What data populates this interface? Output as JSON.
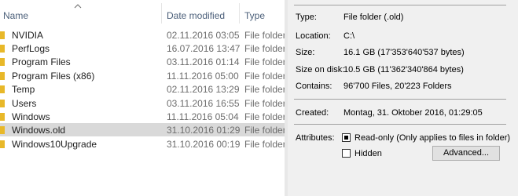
{
  "explorer": {
    "columns": {
      "name": "Name",
      "date_modified": "Date modified",
      "type": "Type"
    },
    "sort_indicator_icon": "chevron-up-icon",
    "folder_icon_color": "#e8b829",
    "selected_row_color": "#d9d9d9",
    "rows": [
      {
        "name": "NVIDIA",
        "date": "02.11.2016 03:05",
        "type": "File folder",
        "selected": false
      },
      {
        "name": "PerfLogs",
        "date": "16.07.2016 13:47",
        "type": "File folder",
        "selected": false
      },
      {
        "name": "Program Files",
        "date": "03.11.2016 01:14",
        "type": "File folder",
        "selected": false
      },
      {
        "name": "Program Files (x86)",
        "date": "11.11.2016 05:00",
        "type": "File folder",
        "selected": false
      },
      {
        "name": "Temp",
        "date": "02.11.2016 13:29",
        "type": "File folder",
        "selected": false
      },
      {
        "name": "Users",
        "date": "03.11.2016 16:55",
        "type": "File folder",
        "selected": false
      },
      {
        "name": "Windows",
        "date": "11.11.2016 05:04",
        "type": "File folder",
        "selected": false
      },
      {
        "name": "Windows.old",
        "date": "31.10.2016 01:29",
        "type": "File folder",
        "selected": true
      },
      {
        "name": "Windows10Upgrade",
        "date": "31.10.2016 00:19",
        "type": "File folder",
        "selected": false
      }
    ]
  },
  "properties": {
    "type_label": "Type:",
    "type_value": "File folder (.old)",
    "location_label": "Location:",
    "location_value": "C:\\",
    "size_label": "Size:",
    "size_value": "16.1 GB (17'353'640'537 bytes)",
    "size_on_disk_label": "Size on disk:",
    "size_on_disk_value": "10.5 GB (11'362'340'864 bytes)",
    "contains_label": "Contains:",
    "contains_value": "96'700 Files, 20'223 Folders",
    "created_label": "Created:",
    "created_value": "Montag, 31. Oktober 2016, 01:29:05",
    "attributes_label": "Attributes:",
    "readonly_label": "Read-only (Only applies to files in folder)",
    "readonly_state": "indeterminate",
    "hidden_label": "Hidden",
    "hidden_state": "unchecked",
    "advanced_label": "Advanced..."
  }
}
